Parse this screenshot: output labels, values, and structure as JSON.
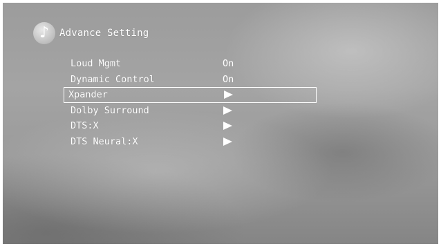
{
  "header": {
    "icon": "music-note-icon",
    "title": "Advance Setting"
  },
  "menu": {
    "items": [
      {
        "label": "Loud Mgmt",
        "value": "On",
        "type": "value"
      },
      {
        "label": "Dynamic Control",
        "value": "On",
        "type": "value"
      },
      {
        "label": "Xpander",
        "icon": "play-arrow-icon",
        "type": "submenu",
        "selected": true
      },
      {
        "label": "Dolby Surround",
        "icon": "play-arrow-icon",
        "type": "submenu"
      },
      {
        "label": "DTS:X",
        "icon": "play-arrow-icon",
        "type": "submenu"
      },
      {
        "label": "DTS Neural:X",
        "icon": "play-arrow-icon",
        "type": "submenu"
      }
    ]
  },
  "colors": {
    "text": "#ffffff",
    "background": "#9c9c9c",
    "selection_border": "#ffffff"
  }
}
